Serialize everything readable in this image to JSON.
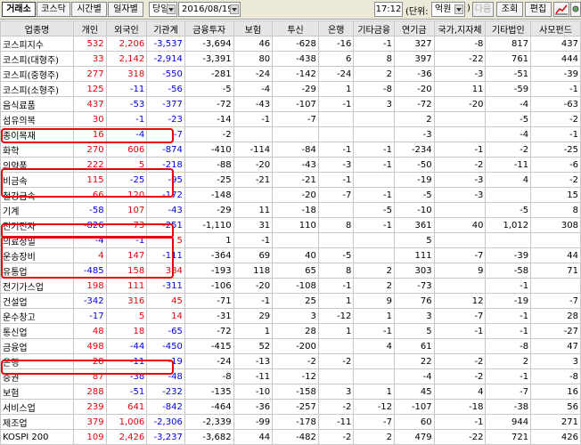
{
  "toolbar": {
    "tabs": [
      "거래소",
      "코스닥",
      "시간별",
      "일자별"
    ],
    "period_select": "당일",
    "date_select": "2016/08/19",
    "time": "17:12",
    "unit_label": "(단위:",
    "unit_select": "억원",
    "unit_close": ")",
    "next_button": "다음",
    "search_button": "조회",
    "edit_button": "편집"
  },
  "table": {
    "headers": [
      "업종명",
      "개인",
      "외국인",
      "기관계",
      "금융투자",
      "보험",
      "투신",
      "은행",
      "기타금융",
      "연기금",
      "국가,지자체",
      "기타법인",
      "사모펀드"
    ],
    "rows": [
      [
        "코스피지수",
        "532",
        "2,206",
        "-3,537",
        "-3,694",
        "46",
        "-628",
        "-16",
        "-1",
        "327",
        "-8",
        "817",
        "437"
      ],
      [
        "코스피(대형주)",
        "33",
        "2,142",
        "-2,914",
        "-3,391",
        "80",
        "-438",
        "6",
        "8",
        "397",
        "-22",
        "761",
        "444"
      ],
      [
        "코스피(중형주)",
        "277",
        "318",
        "-550",
        "-281",
        "-24",
        "-142",
        "-24",
        "2",
        "-36",
        "-3",
        "-51",
        "-39"
      ],
      [
        "코스피(소형주)",
        "125",
        "-11",
        "-56",
        "-5",
        "-4",
        "-29",
        "1",
        "-8",
        "-20",
        "11",
        "-59",
        "-1"
      ],
      [
        "음식료품",
        "437",
        "-53",
        "-377",
        "-72",
        "-43",
        "-107",
        "-1",
        "3",
        "-72",
        "-20",
        "-4",
        "-63"
      ],
      [
        "섬유의복",
        "30",
        "-1",
        "-23",
        "-14",
        "-1",
        "-7",
        "",
        "",
        "2",
        "",
        "-5",
        "-2"
      ],
      [
        "종이목재",
        "16",
        "-4",
        "-7",
        "-2",
        "",
        "",
        "",
        "",
        "-3",
        "",
        "-4",
        "-1"
      ],
      [
        "화학",
        "270",
        "606",
        "-874",
        "-410",
        "-114",
        "-84",
        "-1",
        "-1",
        "-234",
        "-1",
        "-2",
        "-25"
      ],
      [
        "의약품",
        "222",
        "5",
        "-218",
        "-88",
        "-20",
        "-43",
        "-3",
        "-1",
        "-50",
        "-2",
        "-11",
        "-6"
      ],
      [
        "비금속",
        "115",
        "-25",
        "-95",
        "-25",
        "-21",
        "-21",
        "-1",
        "",
        "-19",
        "-3",
        "4",
        "-2"
      ],
      [
        "철강금속",
        "66",
        "120",
        "-172",
        "-148",
        "",
        "-20",
        "-7",
        "-1",
        "-5",
        "-3",
        "",
        "15"
      ],
      [
        "기계",
        "-58",
        "107",
        "-43",
        "-29",
        "11",
        "-18",
        "",
        "-5",
        "-10",
        "",
        "-5",
        "8"
      ],
      [
        "전기전자",
        "-826",
        "73",
        "-251",
        "-1,110",
        "31",
        "110",
        "8",
        "-1",
        "361",
        "40",
        "1,012",
        "308"
      ],
      [
        "의료정밀",
        "-4",
        "-1",
        "5",
        "1",
        "-1",
        "",
        "",
        "",
        "5",
        "",
        "",
        ""
      ],
      [
        "운송장비",
        "4",
        "147",
        "-111",
        "-364",
        "69",
        "40",
        "-5",
        "",
        "111",
        "-7",
        "-39",
        "44"
      ],
      [
        "유통업",
        "-485",
        "158",
        "384",
        "-193",
        "118",
        "65",
        "8",
        "2",
        "303",
        "9",
        "-58",
        "71"
      ],
      [
        "전기가스업",
        "198",
        "111",
        "-311",
        "-106",
        "-20",
        "-108",
        "-1",
        "2",
        "-73",
        "",
        "-1",
        ""
      ],
      [
        "건설업",
        "-342",
        "316",
        "45",
        "-71",
        "-1",
        "25",
        "1",
        "9",
        "76",
        "12",
        "-19",
        "-7"
      ],
      [
        "운수창고",
        "-17",
        "5",
        "14",
        "-31",
        "29",
        "3",
        "-12",
        "1",
        "3",
        "-7",
        "-1",
        "28"
      ],
      [
        "통신업",
        "48",
        "18",
        "-65",
        "-72",
        "1",
        "28",
        "1",
        "-1",
        "5",
        "-1",
        "-1",
        "-27"
      ],
      [
        "금융업",
        "498",
        "-44",
        "-450",
        "-415",
        "52",
        "-200",
        "",
        "4",
        "61",
        "",
        "-8",
        "47"
      ],
      [
        "은행",
        "28",
        "-11",
        "-19",
        "-24",
        "-13",
        "-2",
        "-2",
        "",
        "22",
        "-2",
        "2",
        "3"
      ],
      [
        "증권",
        "87",
        "-38",
        "-48",
        "-8",
        "-11",
        "-12",
        "",
        "",
        "-4",
        "-2",
        "-1",
        "-8"
      ],
      [
        "보험",
        "288",
        "-51",
        "-232",
        "-135",
        "-10",
        "-158",
        "3",
        "1",
        "45",
        "4",
        "-7",
        "16"
      ],
      [
        "서비스업",
        "239",
        "641",
        "-842",
        "-464",
        "-36",
        "-257",
        "-2",
        "-12",
        "-107",
        "-18",
        "-38",
        "56"
      ],
      [
        "제조업",
        "379",
        "1,006",
        "-2,306",
        "-2,339",
        "-99",
        "-178",
        "-11",
        "-7",
        "60",
        "-1",
        "944",
        "271"
      ],
      [
        "KOSPI 200",
        "109",
        "2,426",
        "-3,237",
        "-3,682",
        "44",
        "-482",
        "-2",
        "2",
        "479",
        "-22",
        "721",
        "426"
      ]
    ]
  },
  "colors": {
    "positive": "#e8000b",
    "negative": "#0000e8",
    "highlight": "#e8000b",
    "header_bg": "#e6e6e6"
  },
  "icons": [
    "chart-icon",
    "settings-icon"
  ]
}
